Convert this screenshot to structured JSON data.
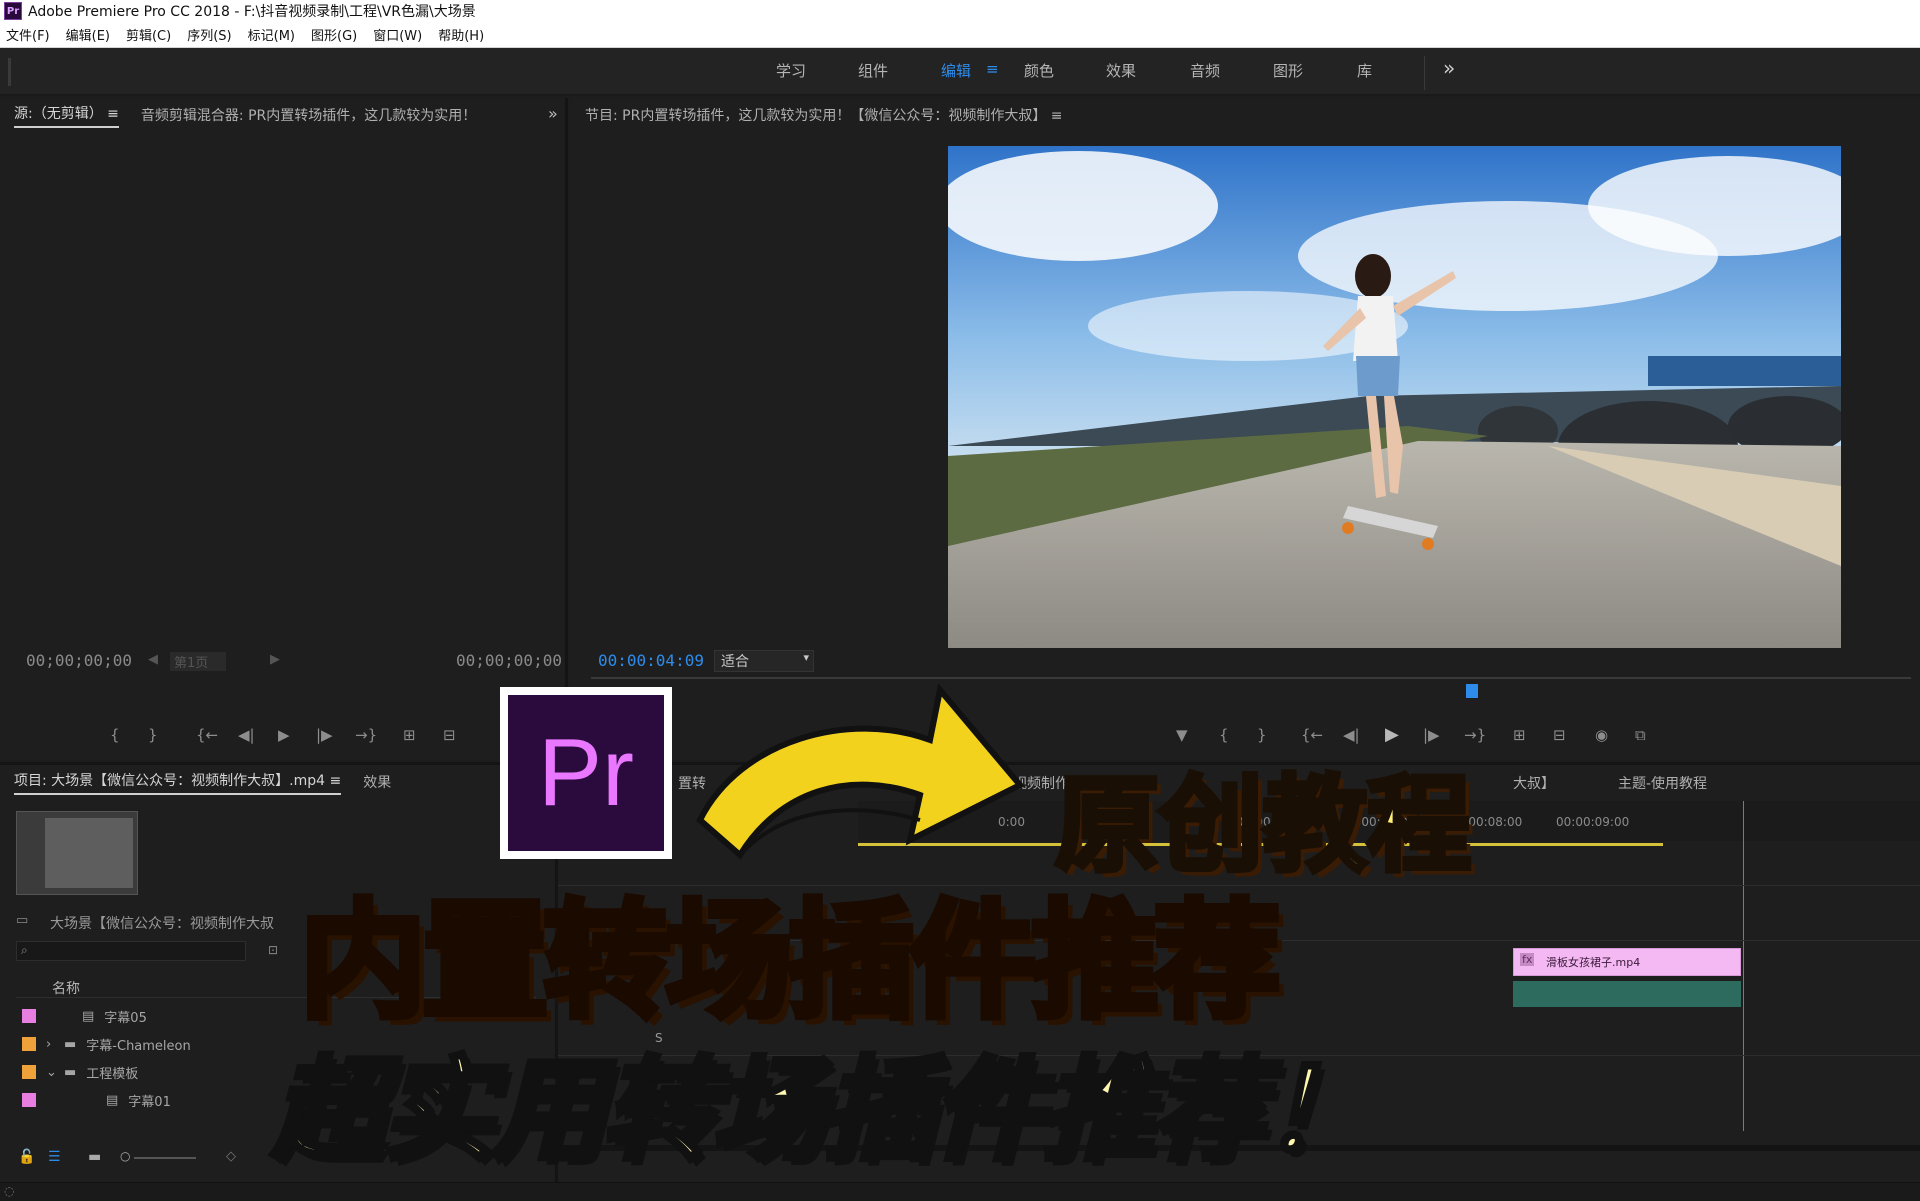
{
  "window": {
    "app_icon": "Pr",
    "title": "Adobe Premiere Pro CC 2018 - F:\\抖音视频录制\\工程\\VR色漏\\大场景"
  },
  "menu": [
    "文件(F)",
    "编辑(E)",
    "剪辑(C)",
    "序列(S)",
    "标记(M)",
    "图形(G)",
    "窗口(W)",
    "帮助(H)"
  ],
  "workspaces": {
    "tabs": [
      "学习",
      "组件",
      "编辑",
      "颜色",
      "效果",
      "音频",
      "图形",
      "库"
    ],
    "active": "编辑",
    "active_menu_icon": "≡",
    "more": "»"
  },
  "source_panel": {
    "tab_source": "源:（无剪辑）",
    "tab_menu": "≡",
    "tab_mixer": "音频剪辑混合器: PR内置转场插件，这几款较为实用！",
    "more": "»",
    "timecode_in": "00;00;00;00",
    "timecode_out": "00;00;00;00",
    "page_label": "第1页"
  },
  "program_panel": {
    "title": "节目: PR内置转场插件，这几款较为实用！【微信公众号：视频制作大叔】",
    "menu": "≡",
    "timecode": "00:00:04:09",
    "fit": "适合"
  },
  "project_panel": {
    "title": "项目: 大场景【微信公众号：视频制作大叔】.mp4",
    "menu": "≡",
    "tab_effects": "效果",
    "bin_name": "大场景【微信公众号：视频制作大叔",
    "column_name": "名称",
    "items": [
      {
        "name": "字幕05",
        "color": "#e77ee0",
        "type": "file"
      },
      {
        "name": "字幕-Chameleon",
        "color": "#f0a23a",
        "type": "folder"
      },
      {
        "name": "工程模板",
        "color": "#f0a23a",
        "type": "folder-open"
      },
      {
        "name": "字幕01",
        "color": "#e77ee0",
        "type": "file"
      }
    ]
  },
  "timeline_panel": {
    "seq_tab_partial": "置转",
    "seq_tab_partial2": "视频制作",
    "seq_tab_partial3": "大叔】",
    "seq_tab_other": "主题-使用教程",
    "time_marks": [
      "00:00:06:00",
      "00:00:07:00",
      "00:00:08:00",
      "00:00:09:00"
    ],
    "time_mark_partial": "0:00",
    "clip_label": "滑板女孩裙子.mp4",
    "clip_fx": "fx",
    "track_s": "S"
  },
  "overlay": {
    "logo_text": "Pr",
    "original": "原创教程",
    "headline": "内置转场插件推荐",
    "subline": "超实用转场插件推荐！"
  },
  "colors": {
    "accent_blue": "#2d8ceb",
    "clip_pink": "#f4b8f2",
    "headline_orange": "#ff9d1c",
    "original_yellow": "#ffef7a",
    "logo_purple": "#2b0a3d"
  }
}
